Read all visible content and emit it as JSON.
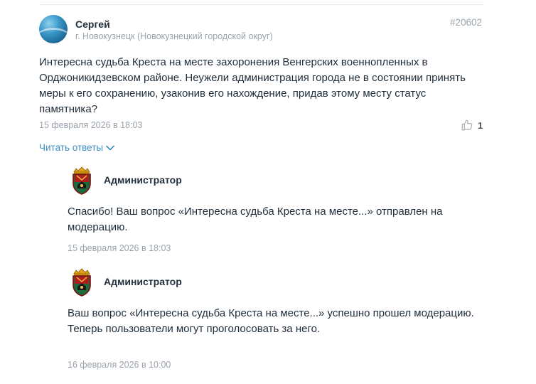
{
  "comment": {
    "author": "Сергей",
    "location": "г. Новокузнецк (Новокузнецкий городской округ)",
    "id": "#20602",
    "text": "Интересна судьба Креста на месте захоронения Венгерских военнопленных в Орджоникидзевском районе. Неужели администрация города не в состоянии принять меры к его сохранению, узаконив его нахождение, придав этому месту статус памятника?",
    "date": "15 февраля 2026 в 18:03",
    "likes": "1",
    "read_replies_label": "Читать ответы"
  },
  "replies": [
    {
      "author": "Администратор",
      "lines": [
        "Спасибо! Ваш вопрос «Интересна судьба Креста на месте...» отправлен на модерацию."
      ],
      "date": "15 февраля 2026 в 18:03"
    },
    {
      "author": "Администратор",
      "lines": [
        "Ваш вопрос «Интересна судьба Креста на месте...» успешно прошел модерацию.",
        "Теперь пользователи могут проголосовать за него."
      ],
      "date": "16 февраля 2026 в 10:00"
    }
  ],
  "colors": {
    "link": "#3d8fc6",
    "muted": "#9aa3ac",
    "text": "#1f2d3a"
  }
}
